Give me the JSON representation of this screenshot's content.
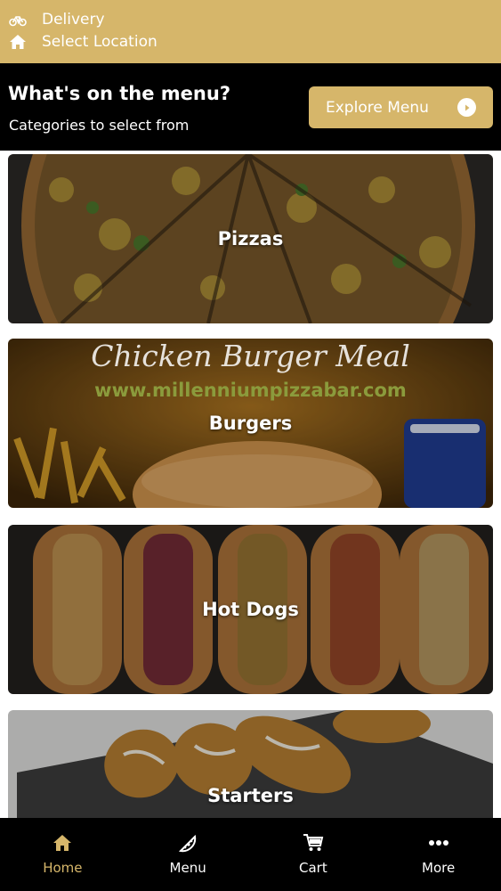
{
  "colors": {
    "accent": "#d6b66a",
    "dark": "#000000",
    "text": "#ffffff"
  },
  "topbar": {
    "delivery_label": "Delivery",
    "location_label": "Select Location",
    "delivery_icon": "bicycle-icon",
    "location_icon": "home-icon"
  },
  "header": {
    "title": "What's on the menu?",
    "subtitle": "Categories to select from",
    "explore_button": "Explore Menu",
    "explore_icon": "circle-arrow-right-icon"
  },
  "categories": [
    {
      "label": "Pizzas"
    },
    {
      "label": "Burgers",
      "banner_title": "Chicken Burger Meal",
      "banner_url": "www.millenniumpizzabar.com"
    },
    {
      "label": "Hot Dogs"
    },
    {
      "label": "Starters"
    }
  ],
  "bottom_nav": [
    {
      "label": "Home",
      "icon": "home-icon",
      "active": true
    },
    {
      "label": "Menu",
      "icon": "pizza-slice-icon",
      "active": false
    },
    {
      "label": "Cart",
      "icon": "cart-icon",
      "active": false
    },
    {
      "label": "More",
      "icon": "more-dots-icon",
      "active": false
    }
  ]
}
